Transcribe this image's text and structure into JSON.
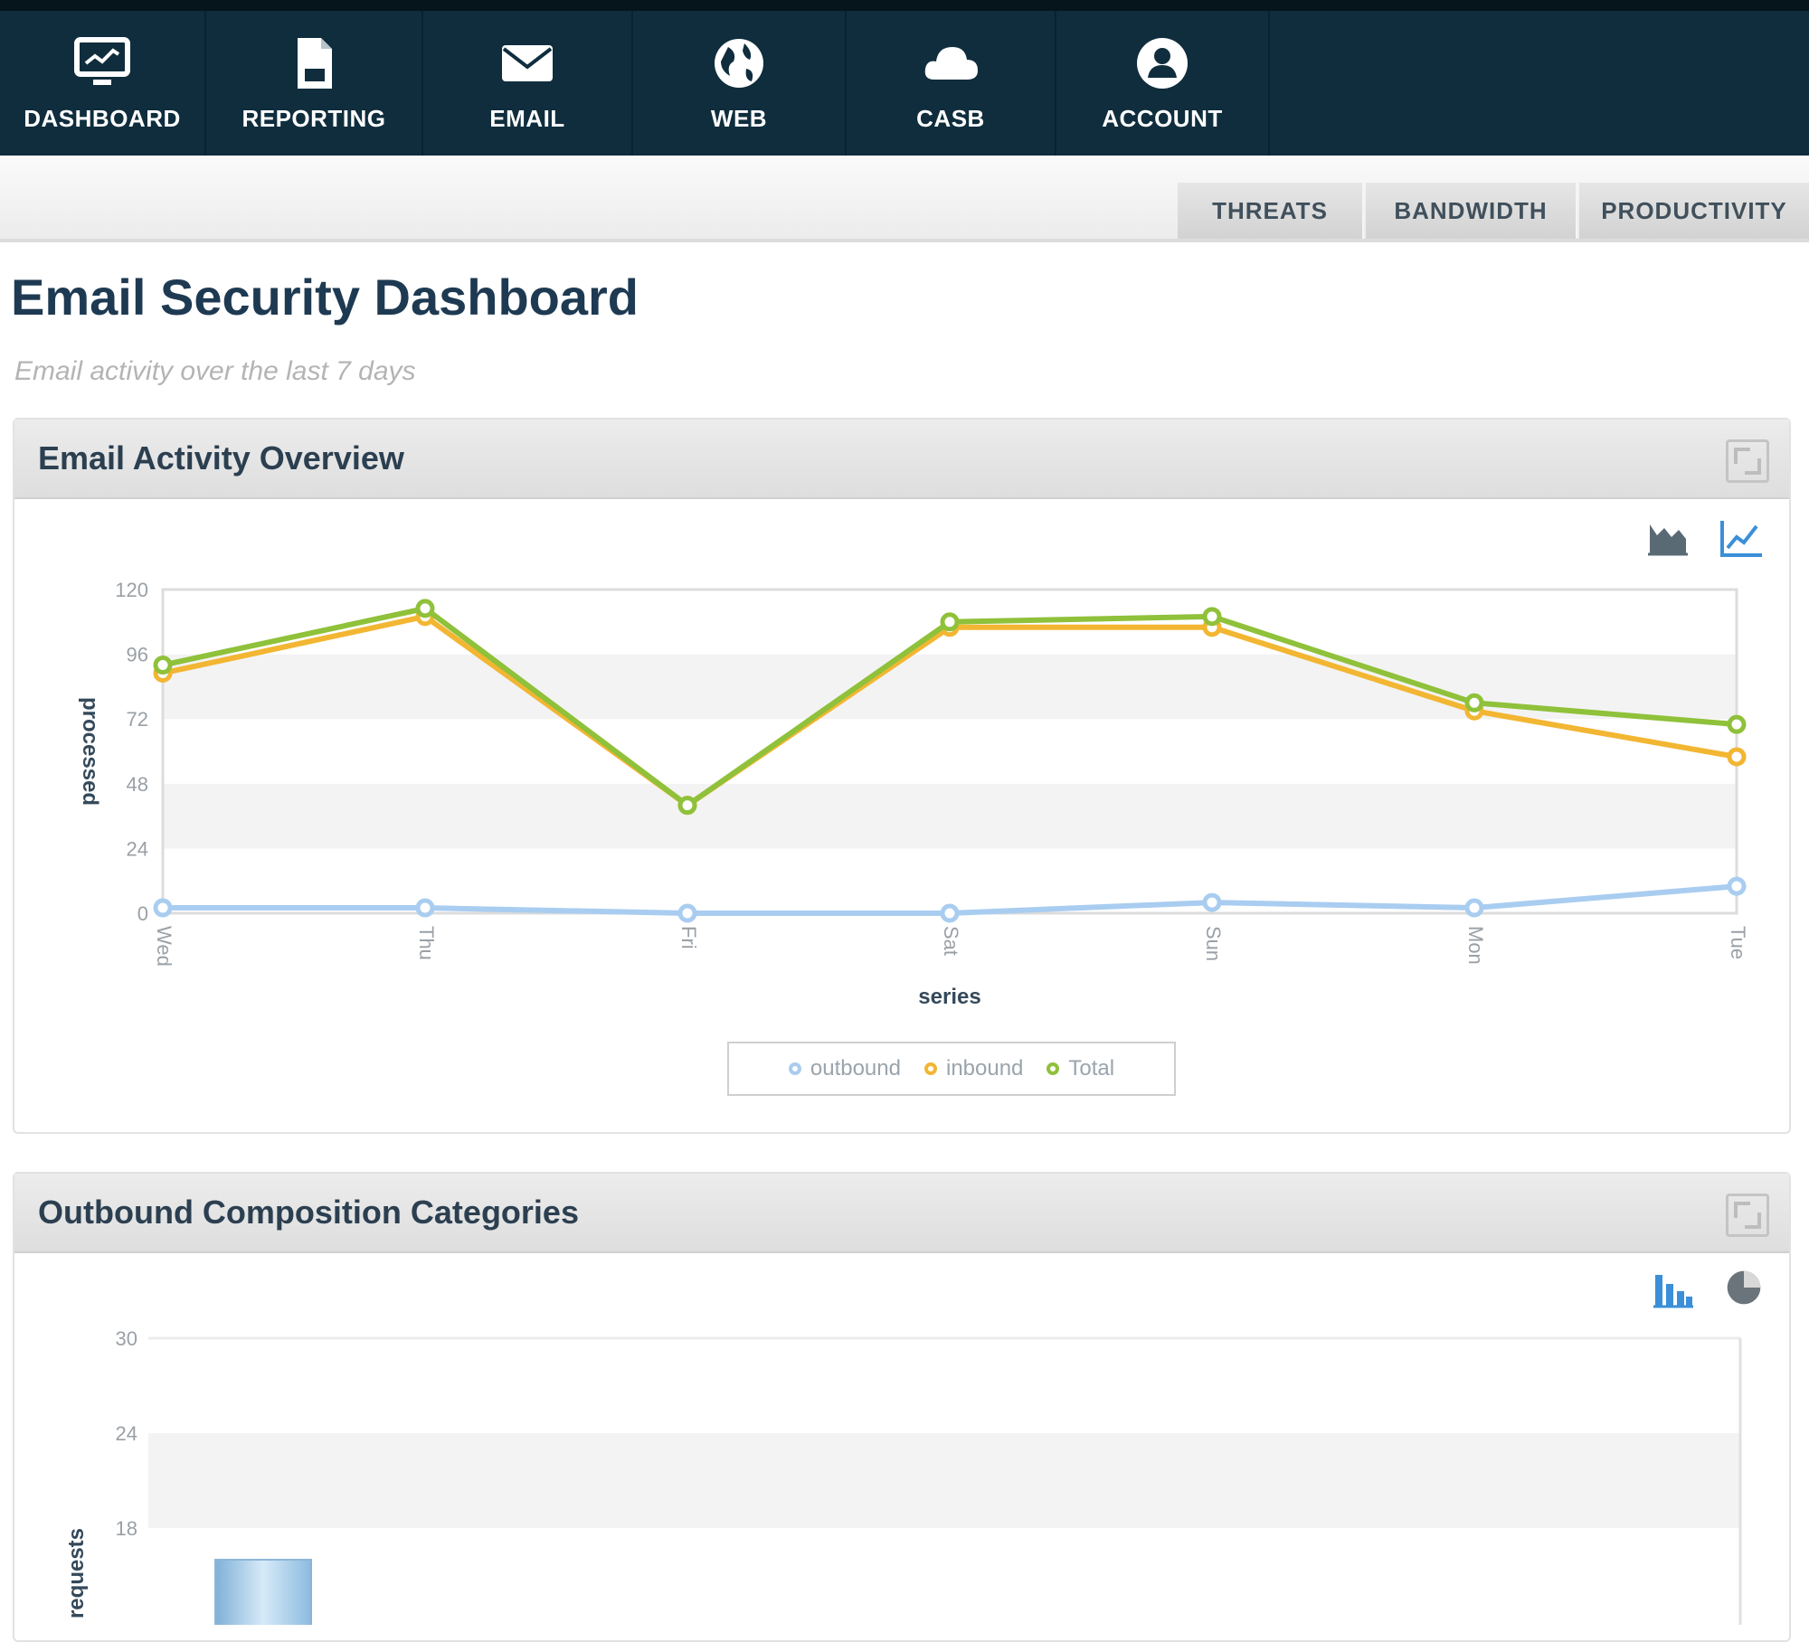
{
  "nav": {
    "items": [
      {
        "label": "DASHBOARD",
        "icon": "monitor-icon"
      },
      {
        "label": "REPORTING",
        "icon": "document-icon"
      },
      {
        "label": "EMAIL",
        "icon": "envelope-icon"
      },
      {
        "label": "WEB",
        "icon": "globe-icon"
      },
      {
        "label": "CASB",
        "icon": "cloud-icon"
      },
      {
        "label": "ACCOUNT",
        "icon": "user-icon"
      }
    ]
  },
  "subtabs": [
    "THREATS",
    "BANDWIDTH",
    "PRODUCTIVITY"
  ],
  "page": {
    "title": "Email Security Dashboard",
    "subtitle": "Email activity over the last 7 days"
  },
  "panels": {
    "activity": {
      "title": "Email Activity Overview"
    },
    "composition": {
      "title": "Outbound Composition Categories"
    }
  },
  "colors": {
    "nav_bg": "#0f2d3d",
    "outbound": "#a9cdf0",
    "inbound": "#f2b632",
    "total": "#8fc13a",
    "bar": "#a9cdeb"
  },
  "chart_data": [
    {
      "type": "line",
      "xlabel": "series",
      "ylabel": "processed",
      "categories": [
        "Wed",
        "Thu",
        "Fri",
        "Sat",
        "Sun",
        "Mon",
        "Tue"
      ],
      "ylim": [
        0,
        120
      ],
      "yticks": [
        "0",
        "24",
        "48",
        "72",
        "96",
        "120"
      ],
      "grid": true,
      "legend_placement": "bottom-center",
      "series": [
        {
          "name": "outbound",
          "values": [
            2,
            2,
            0,
            0,
            4,
            2,
            10
          ]
        },
        {
          "name": "inbound",
          "values": [
            89,
            110,
            40,
            106,
            106,
            75,
            58
          ]
        },
        {
          "name": "Total",
          "values": [
            92,
            113,
            40,
            108,
            110,
            78,
            70
          ]
        }
      ]
    },
    {
      "type": "bar",
      "ylabel": "requests",
      "ylim": [
        0,
        30
      ],
      "yticks": [
        "18",
        "24",
        "30"
      ],
      "values": [
        16
      ]
    }
  ]
}
